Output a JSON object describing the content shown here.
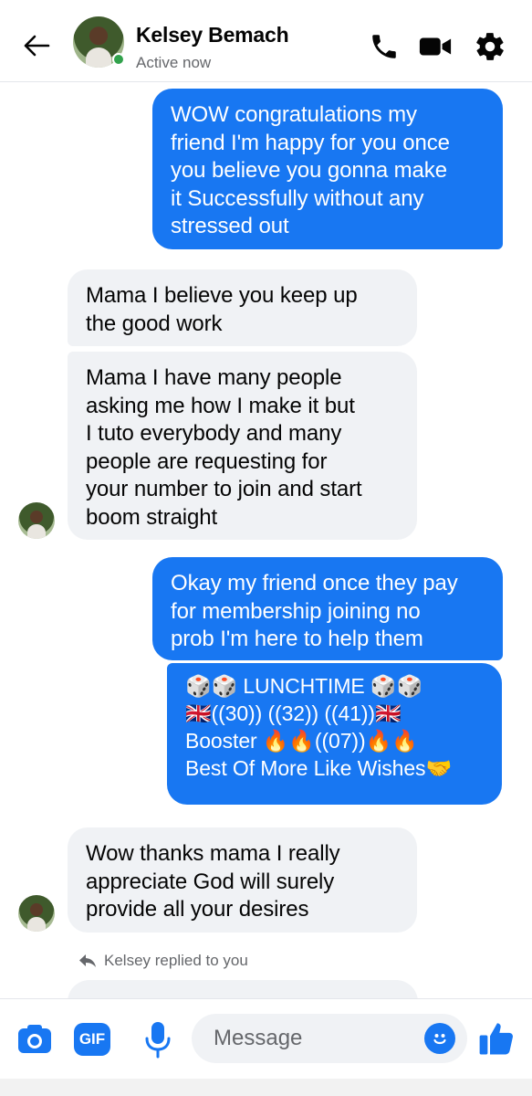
{
  "header": {
    "contact_name": "Kelsey Bemach",
    "status": "Active now"
  },
  "messages": [
    {
      "direction": "outgoing",
      "text": "WOW congratulations my\nfriend I'm happy for you once\nyou believe you gonna make\nit Successfully without any\nstressed out"
    },
    {
      "direction": "incoming",
      "text": "Mama I believe you keep up\nthe good work"
    },
    {
      "direction": "incoming",
      "text": "Mama I have many people\nasking me how I make it but\nI tuto everybody and many\npeople are requesting for\nyour number to join and start\nboom straight"
    },
    {
      "direction": "outgoing",
      "text": "Okay my friend once they pay\nfor membership joining no\nprob I'm here to help them"
    },
    {
      "direction": "outgoing",
      "lines": [
        "🎲🎲 LUNCHTIME 🎲🎲",
        "🇬🇧((30)) ((32)) ((41))🇬🇧",
        "Booster 🔥🔥((07))🔥🔥",
        "Best Of More Like Wishes🤝"
      ]
    },
    {
      "direction": "incoming",
      "text": "Wow thanks mama I really\nappreciate God will surely\nprovide all your desires"
    }
  ],
  "reply_note": "Kelsey replied to you",
  "composer": {
    "placeholder": "Message",
    "gif_label": "GIF"
  },
  "colors": {
    "accent": "#1877f2",
    "incoming_bubble": "#f0f2f5",
    "online": "#31a24c"
  },
  "icons": [
    "back-arrow-icon",
    "phone-icon",
    "video-camera-icon",
    "gear-icon",
    "camera-icon",
    "gif-icon",
    "microphone-icon",
    "emoji-icon",
    "thumbs-up-icon",
    "reply-arrow-icon"
  ]
}
